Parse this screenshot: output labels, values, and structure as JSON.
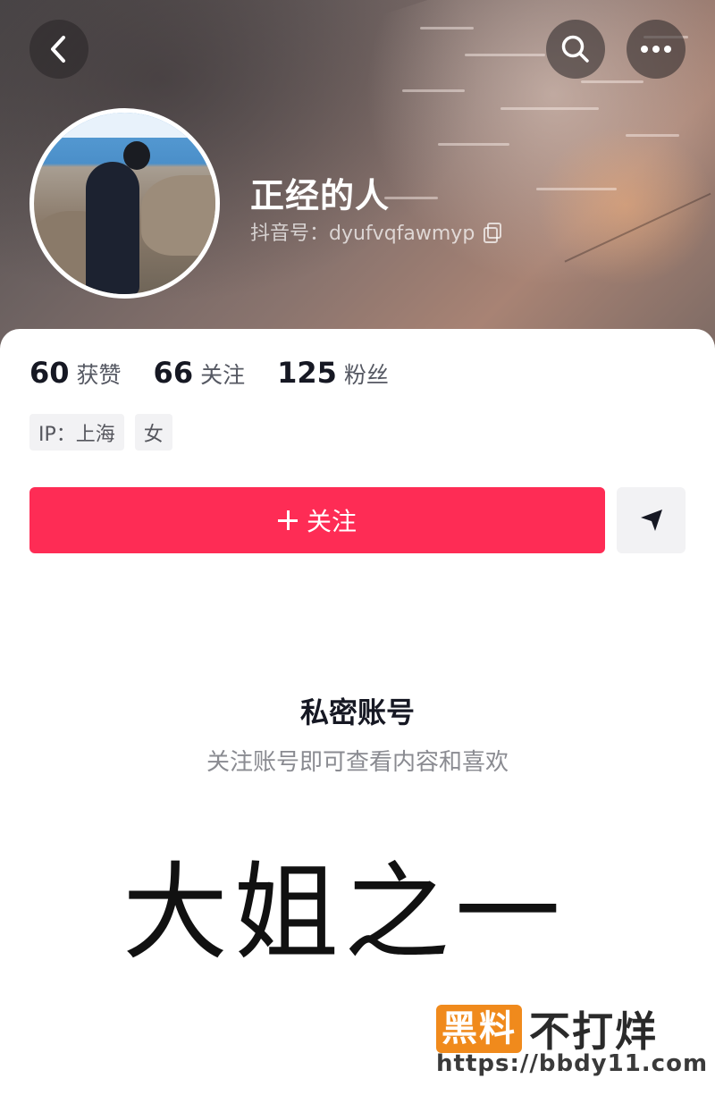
{
  "header": {
    "back_icon": "chevron-left-icon",
    "search_icon": "search-icon",
    "more_icon": "more-horizontal-icon"
  },
  "profile": {
    "name": "正经的人",
    "douyin_id": "抖音号：dyufvqfawmyp",
    "copy_icon": "copy-icon"
  },
  "stats": [
    {
      "value": "60",
      "label": "获赞"
    },
    {
      "value": "66",
      "label": "关注"
    },
    {
      "value": "125",
      "label": "粉丝"
    }
  ],
  "tags": [
    "IP：上海",
    "女"
  ],
  "actions": {
    "follow_label": "关注",
    "follow_color": "#fe2c55",
    "message_icon": "send-icon"
  },
  "private": {
    "title": "私密账号",
    "description": "关注账号即可查看内容和喜欢"
  },
  "caption": "大姐之一",
  "watermark": {
    "brand_box": "黑料",
    "brand_text": "不打烊",
    "url": "https://bbdy11.com"
  }
}
